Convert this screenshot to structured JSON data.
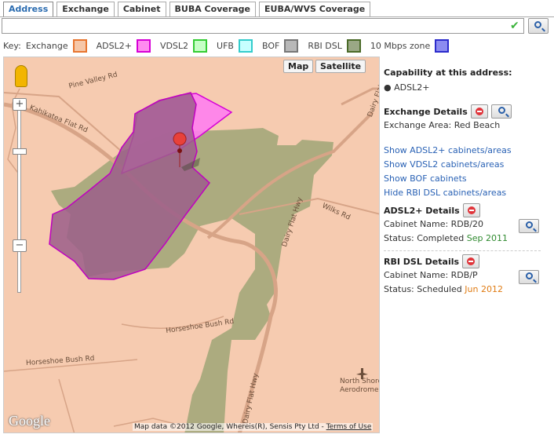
{
  "tabs": [
    {
      "label": "Address",
      "active": true
    },
    {
      "label": "Exchange",
      "active": false
    },
    {
      "label": "Cabinet",
      "active": false
    },
    {
      "label": "BUBA Coverage",
      "active": false
    },
    {
      "label": "EUBA/WVS Coverage",
      "active": false
    }
  ],
  "search": {
    "value": "",
    "placeholder": ""
  },
  "key": {
    "label": "Key:",
    "items": [
      {
        "label": "Exchange",
        "border": "#e8752f",
        "fill": "#f6c7a8"
      },
      {
        "label": "ADSL2+",
        "border": "#d600d6",
        "fill": "#ff8cf0"
      },
      {
        "label": "VDSL2",
        "border": "#33cc33",
        "fill": "#c6ffc6"
      },
      {
        "label": "UFB",
        "border": "#33cccc",
        "fill": "#c7ffff"
      },
      {
        "label": "BOF",
        "border": "#777777",
        "fill": "#b8b8b8"
      },
      {
        "label": "RBI DSL",
        "border": "#4a6a28",
        "fill": "#9aa885"
      },
      {
        "label": "10 Mbps zone",
        "border": "#2b2bcc",
        "fill": "#8c8cf0"
      }
    ]
  },
  "map": {
    "type_buttons": [
      "Map",
      "Satellite"
    ],
    "credit": "Map data ©2012 Google, Whereis(R), Sensis Pty Ltd -",
    "terms": "Terms of Use",
    "logo": "Google",
    "road_labels": [
      "Pine Valley Rd",
      "Kahikatea Flat Rd",
      "Dairy Flat Hwy",
      "Wilks Rd",
      "Horseshoe Bush Rd",
      "Horseshoe Bush Rd",
      "North Shore",
      "Aerodrome",
      "Dairy Flat Hwy",
      "Dairy Flat Hwy"
    ]
  },
  "panel": {
    "capability_title": "Capability at this address:",
    "capability_items": [
      "ADSL2+"
    ],
    "exchange_title": "Exchange Details",
    "exchange_area": "Exchange Area: Red Beach",
    "links": [
      "Show ADSL2+ cabinets/areas",
      "Show VDSL2 cabinets/areas",
      "Show BOF cabinets",
      "Hide RBI DSL cabinets/areas"
    ],
    "adsl_title": "ADSL2+ Details",
    "adsl_cabinet": "Cabinet Name: RDB/20",
    "adsl_status_label": "Status: Completed",
    "adsl_status_date": "Sep 2011",
    "rbi_title": "RBI DSL Details",
    "rbi_cabinet": "Cabinet Name: RDB/P",
    "rbi_status_label": "Status: Scheduled",
    "rbi_status_date": "Jun 2012"
  }
}
